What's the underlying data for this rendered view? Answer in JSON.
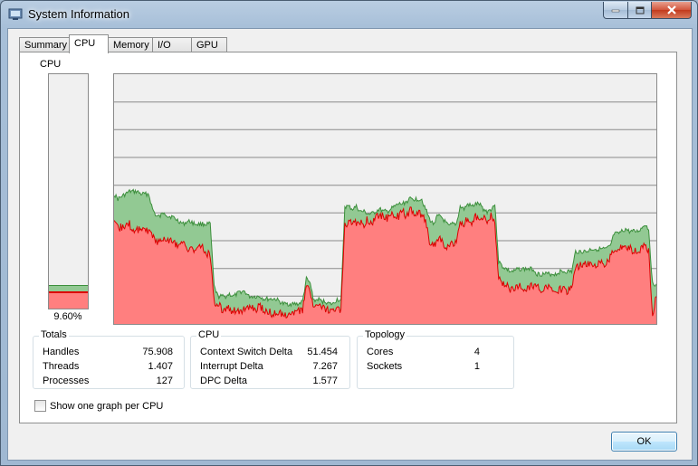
{
  "window": {
    "title": "System Information"
  },
  "icons": {
    "app": "system-information-icon",
    "minimize": "minimize-icon",
    "maximize": "maximize-icon",
    "close": "close-icon"
  },
  "tabs": [
    {
      "label": "Summary",
      "active": false
    },
    {
      "label": "CPU",
      "active": true
    },
    {
      "label": "Memory",
      "active": false
    },
    {
      "label": "I/O",
      "active": false
    },
    {
      "label": "GPU",
      "active": false
    }
  ],
  "cpu_meter": {
    "label": "CPU",
    "percent_text": "9.60%",
    "total_fraction": 0.096,
    "kernel_fraction": 0.065
  },
  "graph": {
    "colors": {
      "total_fill": "#92c993",
      "total_line": "#3c8f3c",
      "kernel_fill": "#ff7f7f",
      "kernel_line": "#dd0000",
      "grid": "#8a8a8a",
      "background": "#f0f0f0"
    },
    "y_max": 100,
    "gridlines": 9,
    "total": [
      52,
      50,
      51,
      52,
      53,
      53,
      53,
      52,
      52,
      52,
      46,
      43,
      43,
      45,
      43,
      43,
      42,
      41,
      40,
      41,
      41,
      40,
      40,
      40,
      40,
      40,
      15,
      11,
      11,
      11,
      12,
      11,
      12,
      13,
      13,
      11,
      11,
      11,
      11,
      10,
      10,
      10,
      10,
      9,
      8,
      8,
      8,
      8,
      8,
      9,
      18,
      16,
      9,
      10,
      9,
      9,
      8,
      8,
      10,
      9,
      47,
      47,
      46,
      47,
      45,
      45,
      44,
      44,
      45,
      46,
      45,
      45,
      46,
      47,
      48,
      48,
      49,
      50,
      50,
      50,
      50,
      46,
      42,
      40,
      43,
      43,
      41,
      39,
      40,
      40,
      47,
      46,
      48,
      47,
      48,
      48,
      46,
      45,
      46,
      48,
      25,
      23,
      22,
      21,
      21,
      22,
      22,
      22,
      22,
      22,
      20,
      20,
      20,
      20,
      20,
      20,
      21,
      21,
      21,
      21,
      29,
      29,
      29,
      29,
      30,
      30,
      30,
      30,
      30,
      31,
      36,
      36,
      37,
      38,
      37,
      37,
      37,
      38,
      40,
      38,
      16,
      16
    ],
    "kernel": [
      40,
      38,
      39,
      39,
      40,
      37,
      38,
      38,
      38,
      37,
      36,
      33,
      33,
      34,
      34,
      33,
      32,
      32,
      32,
      30,
      30,
      30,
      30,
      31,
      28,
      28,
      9,
      8,
      6,
      6,
      6,
      5,
      6,
      5,
      6,
      6,
      6,
      6,
      7,
      5,
      5,
      4,
      4,
      4,
      4,
      4,
      4,
      4,
      5,
      5,
      16,
      13,
      6,
      7,
      6,
      6,
      5,
      5,
      6,
      5,
      40,
      40,
      41,
      40,
      41,
      40,
      42,
      40,
      43,
      44,
      43,
      42,
      44,
      43,
      43,
      45,
      43,
      46,
      44,
      44,
      44,
      41,
      33,
      31,
      34,
      34,
      31,
      31,
      32,
      34,
      41,
      40,
      43,
      39,
      43,
      43,
      43,
      41,
      43,
      40,
      18,
      16,
      16,
      14,
      14,
      15,
      15,
      14,
      15,
      15,
      15,
      14,
      15,
      15,
      13,
      13,
      14,
      14,
      13,
      15,
      23,
      23,
      24,
      24,
      23,
      23,
      24,
      24,
      24,
      27,
      29,
      29,
      31,
      30,
      31,
      29,
      29,
      30,
      31,
      29,
      4,
      11
    ]
  },
  "totals": {
    "title": "Totals",
    "rows": [
      {
        "label": "Handles",
        "value": "75.908"
      },
      {
        "label": "Threads",
        "value": "1.407"
      },
      {
        "label": "Processes",
        "value": "127"
      }
    ]
  },
  "cpu_stats": {
    "title": "CPU",
    "rows": [
      {
        "label": "Context Switch Delta",
        "value": "51.454"
      },
      {
        "label": "Interrupt Delta",
        "value": "7.267"
      },
      {
        "label": "DPC Delta",
        "value": "1.577"
      }
    ]
  },
  "topology": {
    "title": "Topology",
    "rows": [
      {
        "label": "Cores",
        "value": "4"
      },
      {
        "label": "Sockets",
        "value": "1"
      }
    ]
  },
  "checkbox": {
    "label": "Show one graph per CPU",
    "checked": false
  },
  "ok_button": {
    "label": "OK"
  }
}
